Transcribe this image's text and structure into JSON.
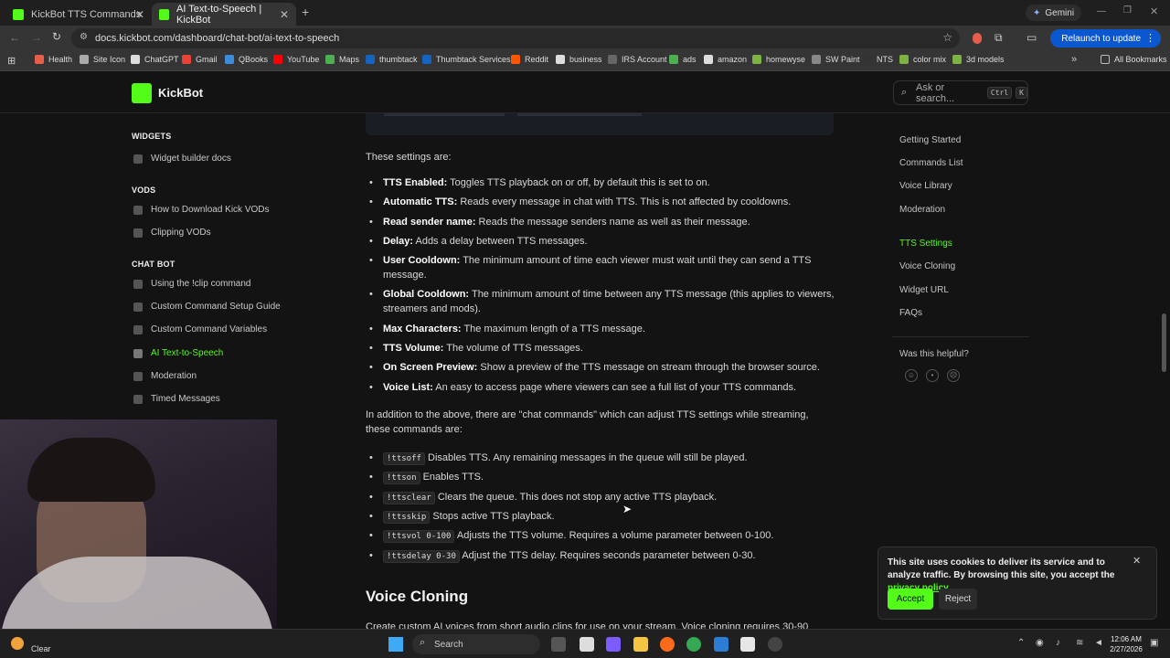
{
  "browser": {
    "tabs": [
      {
        "title": "KickBot TTS Commands",
        "active": false
      },
      {
        "title": "AI Text-to-Speech | KickBot",
        "active": true
      }
    ],
    "gemini_label": "Gemini",
    "url": "docs.kickbot.com/dashboard/chat-bot/ai-text-to-speech",
    "relaunch_label": "Relaunch to update",
    "bookmarks": [
      "Health",
      "Site Icon",
      "ChatGPT",
      "Gmail",
      "QBooks",
      "YouTube",
      "Maps",
      "thumbtack",
      "Thumbtack Services",
      "Reddit",
      "business",
      "IRS Account",
      "ads",
      "amazon",
      "homewyse",
      "SW Paint",
      "NTS",
      "color mix",
      "3d models"
    ],
    "all_bookmarks_label": "All Bookmarks"
  },
  "site": {
    "brand": "KickBot",
    "search_placeholder": "Ask or search...",
    "search_kbd": [
      "Ctrl",
      "K"
    ],
    "accent": "#53fc18"
  },
  "sidebar": {
    "sections": [
      {
        "heading": "WIDGETS",
        "items": [
          {
            "label": "Widget builder docs",
            "active": false
          }
        ]
      },
      {
        "heading": "VODS",
        "items": [
          {
            "label": "How to Download Kick VODs",
            "active": false
          },
          {
            "label": "Clipping VODs",
            "active": false
          }
        ]
      },
      {
        "heading": "CHAT BOT",
        "items": [
          {
            "label": "Using the !clip command",
            "active": false
          },
          {
            "label": "Custom Command Setup Guide",
            "active": false
          },
          {
            "label": "Custom Command Variables",
            "active": false
          },
          {
            "label": "AI Text-to-Speech",
            "active": true
          },
          {
            "label": "Moderation",
            "active": false
          },
          {
            "label": "Timed Messages",
            "active": false
          }
        ]
      }
    ]
  },
  "main": {
    "intro": "These settings are:",
    "settings": [
      {
        "term": "TTS Enabled:",
        "desc": "Toggles TTS playback on or off, by default this is set to on."
      },
      {
        "term": "Automatic TTS:",
        "desc": "Reads every message in chat with TTS. This is not affected by cooldowns."
      },
      {
        "term": "Read sender name:",
        "desc": "Reads the message senders name as well as their message."
      },
      {
        "term": "Delay:",
        "desc": "Adds a delay between TTS messages."
      },
      {
        "term": "User Cooldown:",
        "desc": "The minimum amount of time each viewer must wait until they can send a TTS message."
      },
      {
        "term": "Global Cooldown:",
        "desc": "The minimum amount of time between any TTS message (this applies to viewers, streamers and mods)."
      },
      {
        "term": "Max Characters:",
        "desc": "The maximum length of a TTS message."
      },
      {
        "term": "TTS Volume:",
        "desc": "The volume of TTS messages."
      },
      {
        "term": "On Screen Preview:",
        "desc": "Show a preview of the TTS message on stream through the browser source."
      },
      {
        "term": "Voice List:",
        "desc": "An easy to access page where viewers can see a full list of your TTS commands."
      }
    ],
    "commands_intro": "In addition to the above, there are \"chat commands\" which can adjust TTS settings while streaming, these commands are:",
    "commands": [
      {
        "code": "!ttsoff",
        "desc": "Disables TTS. Any remaining messages in the queue will still be played."
      },
      {
        "code": "!ttson",
        "desc": "Enables TTS."
      },
      {
        "code": "!ttsclear",
        "desc": "Clears the queue. This does not stop any active TTS playback."
      },
      {
        "code": "!ttsskip",
        "desc": "Stops active TTS playback."
      },
      {
        "code": "!ttsvol 0-100",
        "desc": "Adjusts the TTS volume. Requires a volume parameter between 0-100."
      },
      {
        "code": "!ttsdelay 0-30",
        "desc": "Adjust the TTS delay. Requires seconds parameter between 0-30."
      }
    ],
    "next_heading": "Voice Cloning",
    "next_para": "Create custom AI voices from short audio clips for use on your stream. Voice cloning requires 30-90"
  },
  "toc": {
    "items": [
      {
        "label": "Getting Started",
        "active": false
      },
      {
        "label": "Commands List",
        "active": false
      },
      {
        "label": "Voice Library",
        "active": false
      },
      {
        "label": "Moderation",
        "active": false
      },
      {
        "label": "TTS Settings",
        "active": true
      },
      {
        "label": "Voice Cloning",
        "active": false
      },
      {
        "label": "Widget URL",
        "active": false
      },
      {
        "label": "FAQs",
        "active": false
      }
    ],
    "helpful_label": "Was this helpful?"
  },
  "cookie": {
    "text": "This site uses cookies to deliver its service and to analyze traffic. By browsing this site, you accept the",
    "link": "privacy policy",
    "after": ".",
    "accept": "Accept",
    "reject": "Reject"
  },
  "taskbar": {
    "weather": "Clear",
    "search_label": "Search",
    "time": "12:06 AM",
    "date": "2/27/2026"
  }
}
